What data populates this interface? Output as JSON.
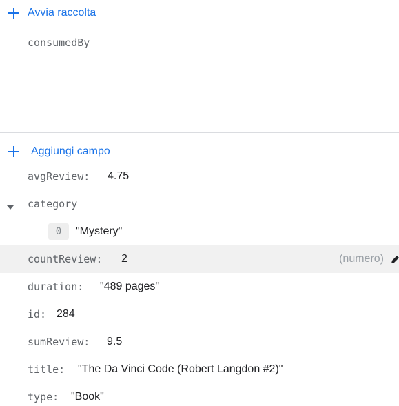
{
  "collection_section": {
    "start_collection_label": "Avvia raccolta",
    "items": [
      "consumedBy"
    ]
  },
  "fields_section": {
    "add_field_label": "Aggiungi campo",
    "fields": {
      "avgReview": {
        "key": "avgReview",
        "value": "4.75"
      },
      "category": {
        "key": "category",
        "expanded": true,
        "items": [
          {
            "index": "0",
            "value": "\"Mystery\""
          }
        ]
      },
      "countReview": {
        "key": "countReview",
        "value": "2",
        "type_hint": "(numero)"
      },
      "duration": {
        "key": "duration",
        "value": "\"489 pages\""
      },
      "id": {
        "key": "id",
        "value": "284"
      },
      "sumReview": {
        "key": "sumReview",
        "value": "9.5"
      },
      "title": {
        "key": "title",
        "value": "\"The Da Vinci Code (Robert Langdon #2)\""
      },
      "type": {
        "key": "type",
        "value": "\"Book\""
      }
    }
  },
  "colors": {
    "accent": "#1a73e8",
    "key_text": "#5f6368",
    "value_text": "#202124",
    "hover_row": "#f1f1f1",
    "divider": "#dadce0"
  },
  "icons": {
    "add": "plus-icon",
    "expand": "caret-down-icon",
    "edit": "pencil-icon"
  }
}
